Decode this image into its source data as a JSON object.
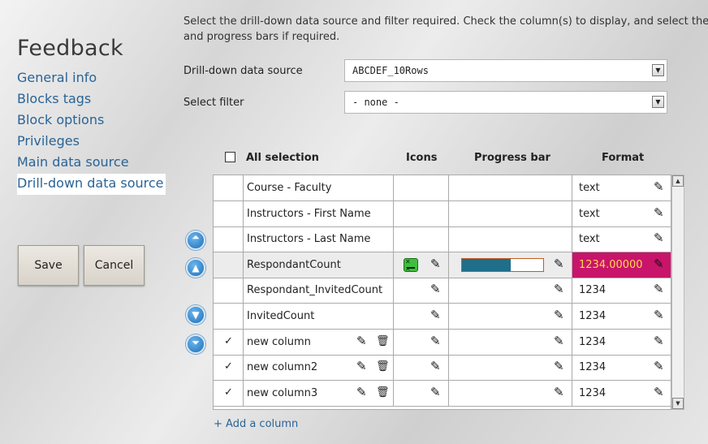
{
  "sidebar": {
    "title": "Feedback",
    "items": [
      {
        "label": "General info"
      },
      {
        "label": "Blocks tags"
      },
      {
        "label": "Block options"
      },
      {
        "label": "Privileges"
      },
      {
        "label": "Main data source"
      },
      {
        "label": "Drill-down data source",
        "active": true
      }
    ],
    "save_label": "Save",
    "cancel_label": "Cancel"
  },
  "intro": {
    "line1": "Select the drill-down data source and filter required. Check the column(s) to display, and select the",
    "line2": "and progress bars if required."
  },
  "form": {
    "source_label": "Drill-down data source",
    "source_value": "ABCDEF_10Rows",
    "filter_label": "Select filter",
    "filter_value": "- none -"
  },
  "table": {
    "headers": {
      "all_selection": "All selection",
      "icons": "Icons",
      "progress_bar": "Progress bar",
      "format": "Format"
    },
    "rows": [
      {
        "checked": "",
        "name": "Course - Faculty",
        "format": "text",
        "icon_edit": false,
        "progress_edit": false,
        "col_actions": false
      },
      {
        "checked": "",
        "name": "Instructors - First Name",
        "format": "text",
        "icon_edit": false,
        "progress_edit": false,
        "col_actions": false
      },
      {
        "checked": "",
        "name": "Instructors - Last Name",
        "format": "text",
        "icon_edit": false,
        "progress_edit": false,
        "col_actions": false
      },
      {
        "checked": "",
        "name": "RespondantCount",
        "format": "1234.00000",
        "icon_edit": true,
        "icon": "smiley-face-icon",
        "progress_edit": true,
        "progress": 0.6,
        "highlight": true,
        "col_actions": false
      },
      {
        "checked": "",
        "name": "Respondant_InvitedCount",
        "format": "1234",
        "icon_edit": true,
        "progress_edit": true,
        "col_actions": false
      },
      {
        "checked": "",
        "name": "InvitedCount",
        "format": "1234",
        "icon_edit": true,
        "progress_edit": true,
        "col_actions": false
      },
      {
        "checked": "✓",
        "name": "new column",
        "format": "1234",
        "icon_edit": true,
        "progress_edit": true,
        "col_actions": true
      },
      {
        "checked": "✓",
        "name": "new column2",
        "format": "1234",
        "icon_edit": true,
        "progress_edit": true,
        "col_actions": true
      },
      {
        "checked": "✓",
        "name": "new column3",
        "format": "1234",
        "icon_edit": true,
        "progress_edit": true,
        "col_actions": true
      }
    ],
    "add_column_label": "+ Add a column"
  },
  "colors": {
    "accent_link": "#2a6496",
    "format_highlight_bg": "#c8146a",
    "format_highlight_text": "#ffd84a",
    "progress_fill": "#1f6f8b"
  }
}
